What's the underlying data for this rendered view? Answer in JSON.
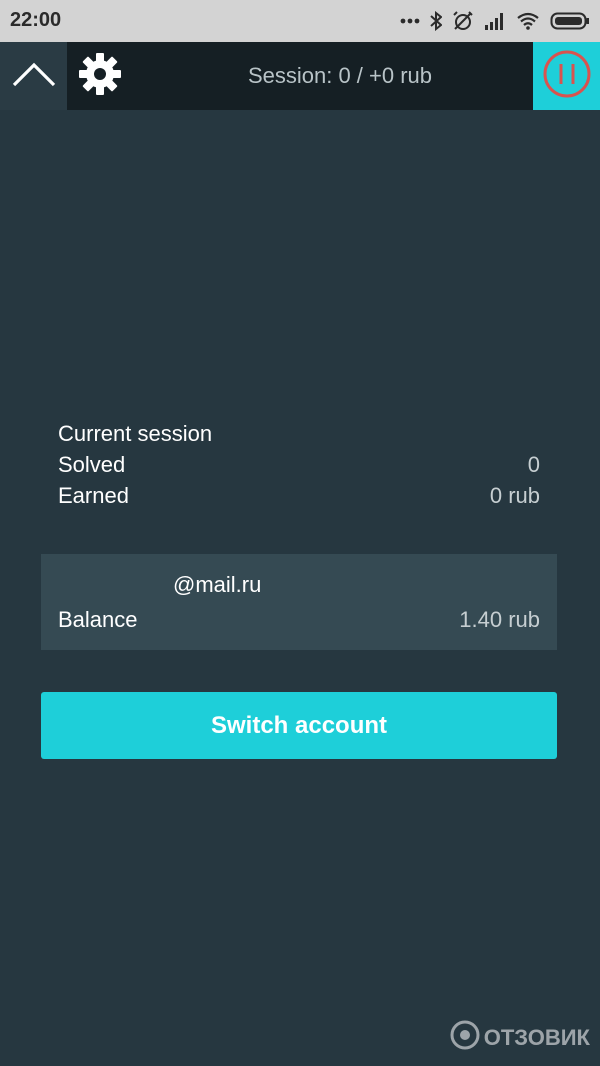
{
  "status_bar": {
    "time": "22:00",
    "icons": [
      "more-dots-icon",
      "bluetooth-icon",
      "alarm-off-icon",
      "signal-icon",
      "wifi-icon",
      "battery-icon"
    ]
  },
  "header": {
    "session_title": "Session: 0 / +0 rub",
    "icons": {
      "collapse": "chevron-up-icon",
      "settings": "gear-icon",
      "pause": "pause-icon"
    },
    "colors": {
      "accent": "#1ecfd9",
      "pause_ring": "#d9534f"
    }
  },
  "current_session": {
    "heading": "Current session",
    "solved_label": "Solved",
    "solved_value": "0",
    "earned_label": "Earned",
    "earned_value": "0 rub"
  },
  "account": {
    "email": "@mail.ru",
    "balance_label": "Balance",
    "balance_value": "1.40 rub"
  },
  "actions": {
    "switch_account_label": "Switch account"
  },
  "watermark": {
    "text": "ОТЗОВИК"
  }
}
